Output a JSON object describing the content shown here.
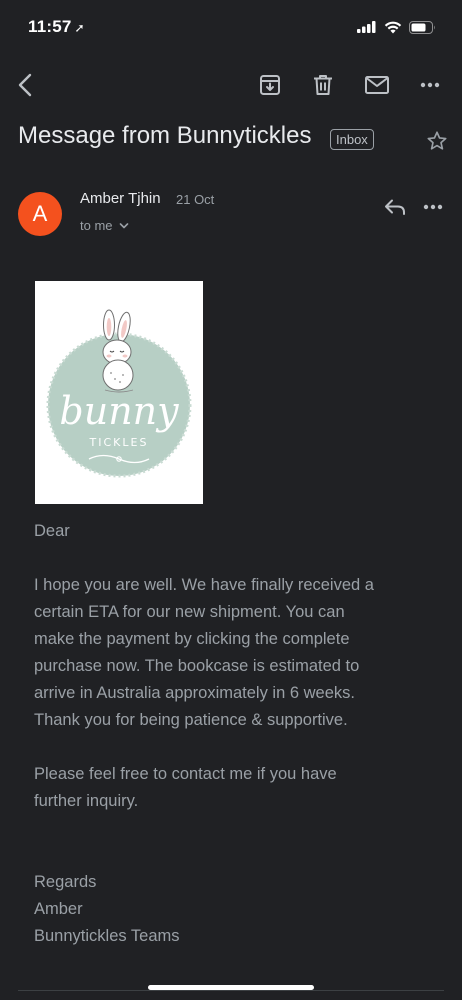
{
  "status_bar": {
    "time": "11:57",
    "location_glyph": "➚",
    "icons": [
      "cellular-signal-icon",
      "wifi-icon",
      "battery-icon"
    ]
  },
  "toolbar": {
    "icons": [
      "back-arrow-icon",
      "archive-icon",
      "trash-icon",
      "mail-icon",
      "more-icon"
    ]
  },
  "message": {
    "subject": "Message from Bunnytickles",
    "label": "Inbox",
    "sender": {
      "initial": "A",
      "name": "Amber Tjhin",
      "date": "21 Oct",
      "recipient": "to me",
      "avatar_color": "#f4511e"
    },
    "logo": {
      "text_main": "bunny",
      "text_sub": "TICKLES"
    },
    "body": {
      "greeting": "Dear",
      "paragraph1_lines": [
        "I hope you are well. We have finally received a",
        "certain ETA for our new shipment. You can",
        "make the payment by clicking the complete",
        "purchase now.  The bookcase is estimated to",
        "arrive in Australia approximately in 6 weeks.",
        "Thank you for being patience & supportive."
      ],
      "paragraph2_lines": [
        "Please feel free to contact me if you have",
        "further inquiry."
      ],
      "signoff_lines": [
        "Regards",
        "Amber",
        "Bunnytickles Teams"
      ]
    }
  },
  "colors": {
    "background": "#202124",
    "text_primary": "#e8eaed",
    "text_secondary": "#9aa0a6",
    "logo_circle": "#b7cfc5"
  }
}
